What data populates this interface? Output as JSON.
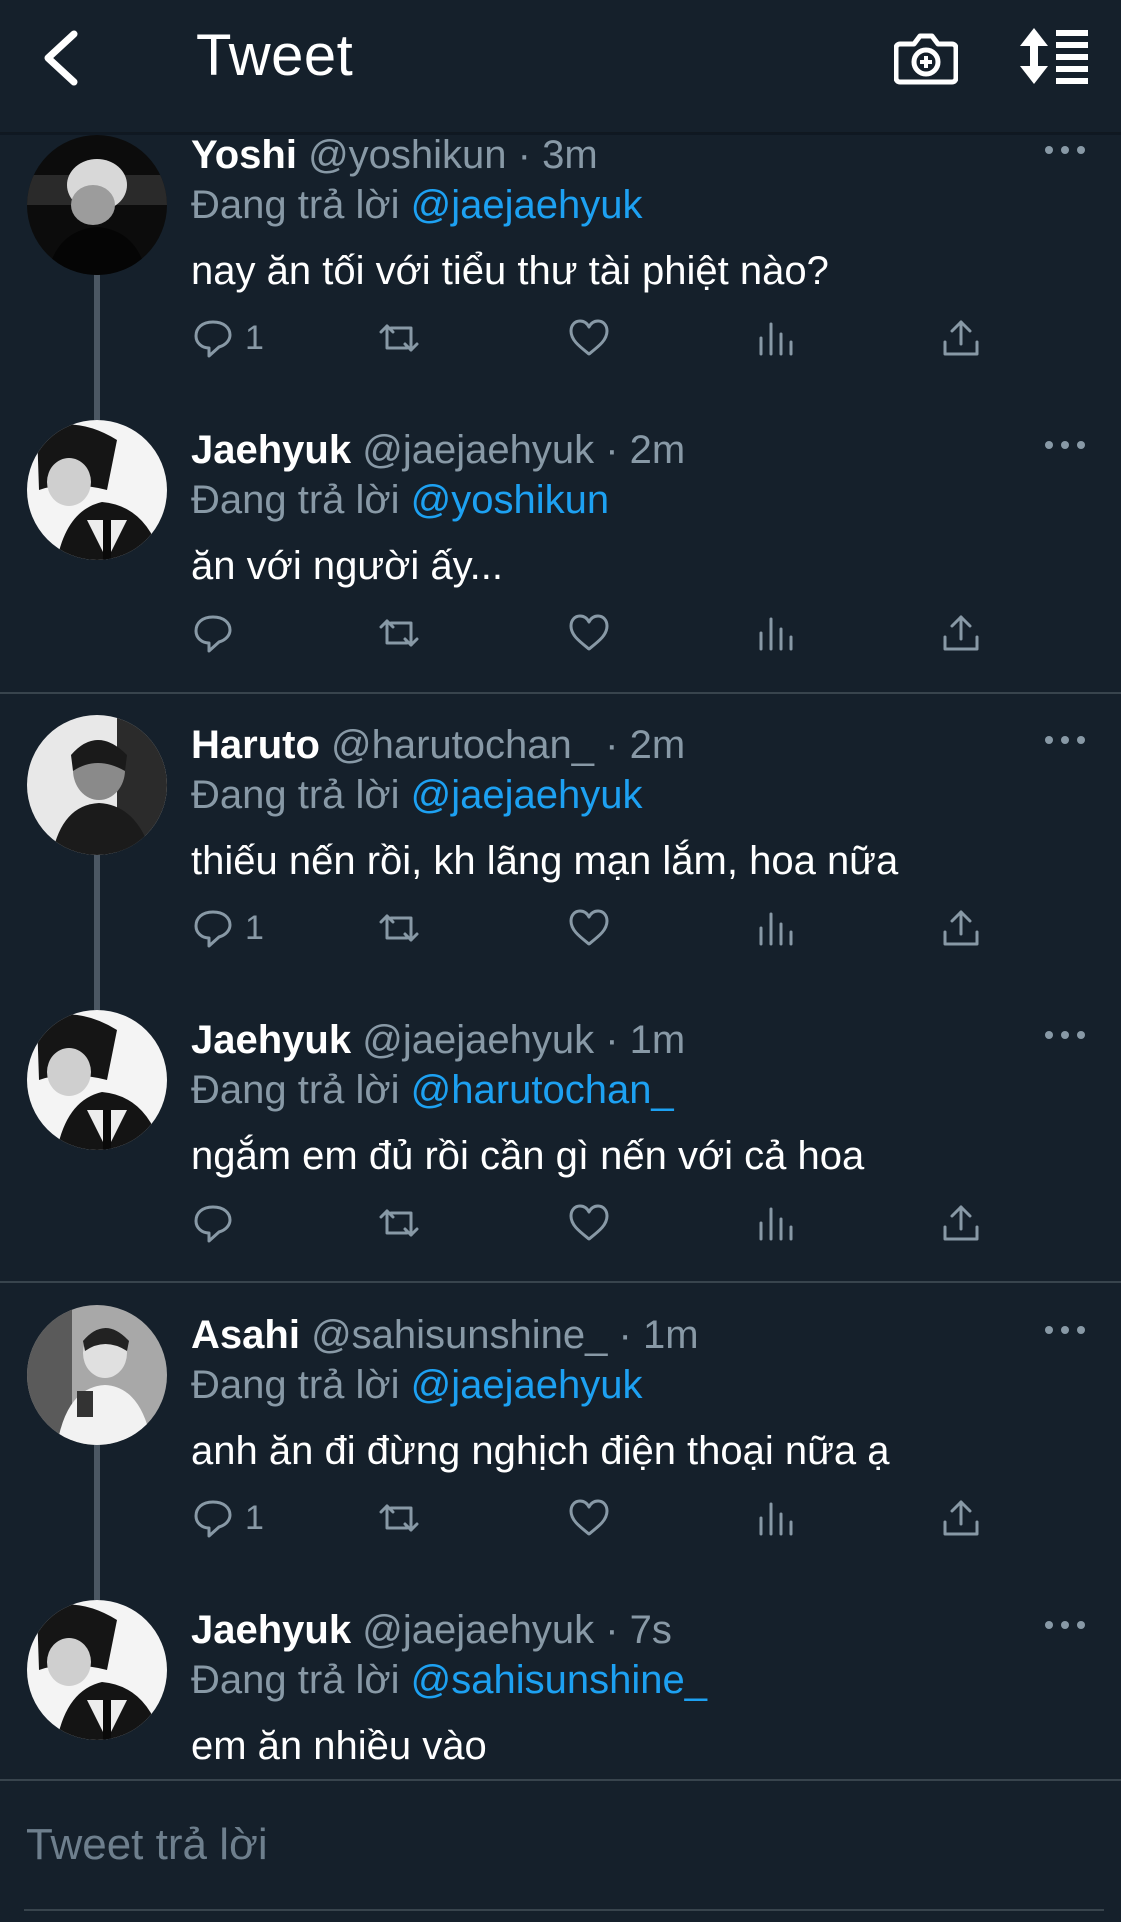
{
  "header": {
    "title": "Tweet",
    "back_icon": "back-chevron-icon",
    "camera_icon": "camera-add-icon",
    "sort_icon": "sort-list-icon"
  },
  "colors": {
    "background": "#15202b",
    "link": "#1da1f2",
    "muted": "#8899a6",
    "divider": "#38444d"
  },
  "reply_prefix": "Đang trả lời",
  "tweets": [
    {
      "name": "Yoshi",
      "handle": "@yoshikun",
      "dot": "·",
      "time": "3m",
      "replying_to": "@jaejaehyuk",
      "text": "nay ăn tối với tiểu thư tài phiệt nào?",
      "reply_count": "1",
      "avatar": "avatar-yoshi"
    },
    {
      "name": "Jaehyuk",
      "handle": "@jaejaehyuk",
      "dot": "·",
      "time": "2m",
      "replying_to": "@yoshikun",
      "text": "ăn với người ấy...",
      "reply_count": "",
      "avatar": "avatar-jaehyuk"
    },
    {
      "name": "Haruto",
      "handle": "@harutochan_",
      "dot": "·",
      "time": "2m",
      "replying_to": "@jaejaehyuk",
      "text": "thiếu nến rồi, kh lãng mạn lắm, hoa nữa",
      "reply_count": "1",
      "avatar": "avatar-haruto"
    },
    {
      "name": "Jaehyuk",
      "handle": "@jaejaehyuk",
      "dot": "·",
      "time": "1m",
      "replying_to": "@harutochan_",
      "text": "ngắm em đủ rồi cần gì nến với cả hoa",
      "reply_count": "",
      "avatar": "avatar-jaehyuk"
    },
    {
      "name": "Asahi",
      "handle": "@sahisunshine_",
      "dot": "·",
      "time": "1m",
      "replying_to": "@jaejaehyuk",
      "text": "anh ăn đi đừng nghịch điện thoại nữa ạ",
      "reply_count": "1",
      "avatar": "avatar-asahi"
    },
    {
      "name": "Jaehyuk",
      "handle": "@jaejaehyuk",
      "dot": "·",
      "time": "7s",
      "replying_to": "@sahisunshine_",
      "text": "em ăn nhiều vào",
      "reply_count": "",
      "avatar": "avatar-jaehyuk"
    }
  ],
  "action_icons": [
    "reply-icon",
    "retweet-icon",
    "like-icon",
    "analytics-icon",
    "share-icon"
  ],
  "reply_box": {
    "placeholder": "Tweet trả lời"
  }
}
